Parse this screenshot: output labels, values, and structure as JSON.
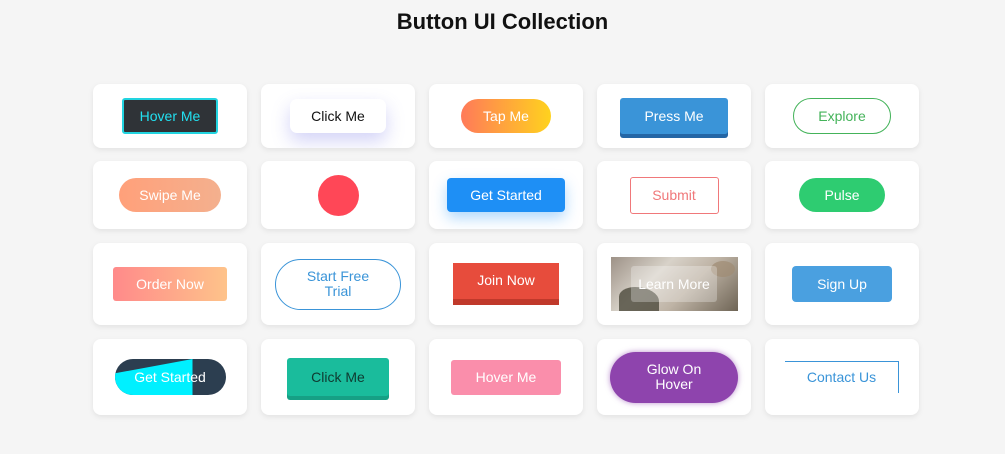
{
  "page": {
    "title": "Button UI Collection"
  },
  "buttons": {
    "hover_me": "Hover Me",
    "click_me": "Click Me",
    "tap_me": "Tap Me",
    "press_me": "Press Me",
    "explore": "Explore",
    "swipe_me": "Swipe Me",
    "circle": "",
    "get_started": "Get Started",
    "submit": "Submit",
    "pulse": "Pulse",
    "order_now": "Order Now",
    "start_free_trial": "Start Free Trial",
    "join_now": "Join Now",
    "learn_more": "Learn More",
    "sign_up": "Sign Up",
    "get_started_2": "Get Started",
    "click_me_2": "Click Me",
    "hover_me_2": "Hover Me",
    "glow_on_hover": "Glow On Hover",
    "contact_us": "Contact Us"
  },
  "colors": {
    "page_bg": "#f5f5f5",
    "card_bg": "#ffffff",
    "cyan": "#22e0f0",
    "blue": "#3a94d8",
    "green": "#2ecc71",
    "red": "#e74c3c",
    "purple": "#8e44ad"
  }
}
